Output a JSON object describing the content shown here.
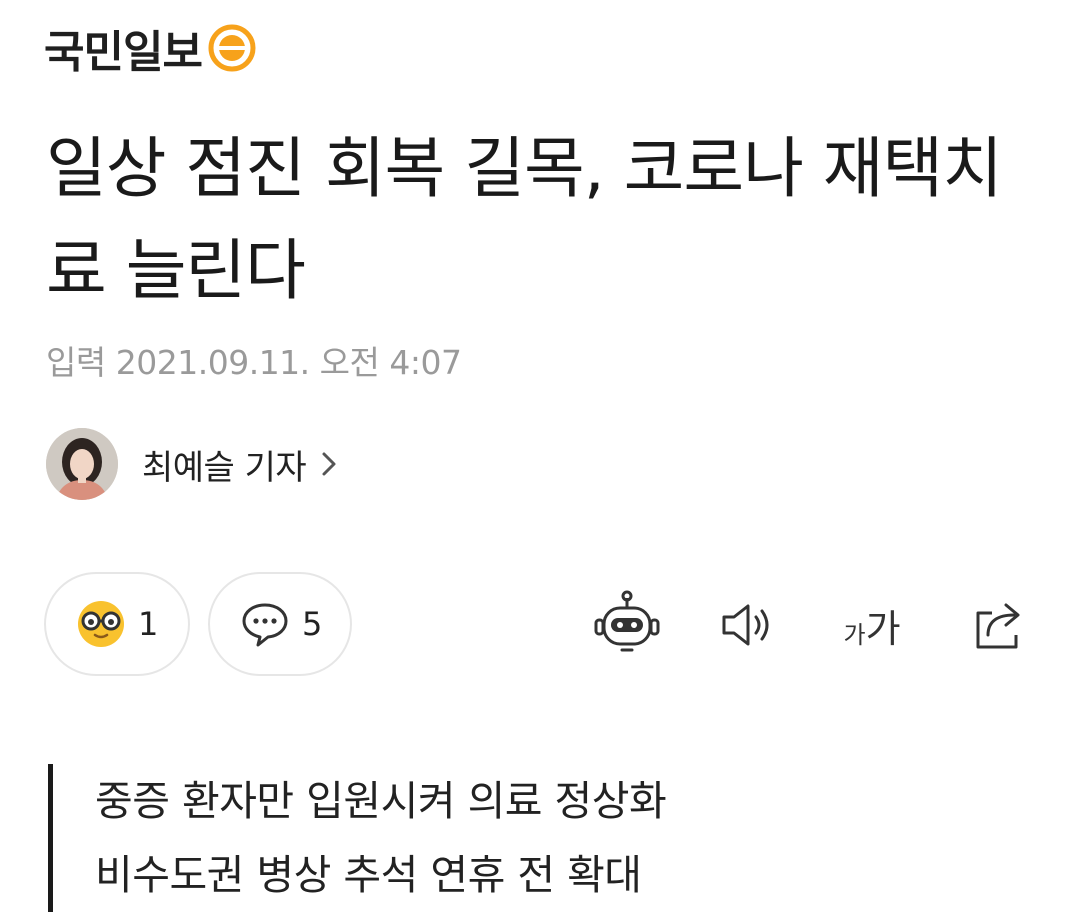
{
  "brand": {
    "name": "국민일보",
    "logo_icon": "kmib-circle-logo",
    "logo_color": "#f7a21b"
  },
  "article": {
    "headline": "일상 점진 회복 길목, 코로나 재택치료 늘린다",
    "date_label": "입력",
    "date_value": "2021.09.11. 오전 4:07"
  },
  "reporter": {
    "name": "최예슬 기자",
    "avatar_icon": "reporter-avatar",
    "chevron_icon": "chevron-right-icon"
  },
  "actions": {
    "reaction_icon": "glasses-face-icon",
    "reaction_count": "1",
    "comment_icon": "speech-bubble-icon",
    "comment_count": "5"
  },
  "tools": {
    "summary_icon": "robot-icon",
    "tts_icon": "speaker-icon",
    "font_small": "가",
    "font_big": "가",
    "share_icon": "share-icon"
  },
  "subheads": [
    "중증 환자만 입원시켜 의료 정상화",
    "비수도권 병상 추석 연휴 전 확대"
  ]
}
